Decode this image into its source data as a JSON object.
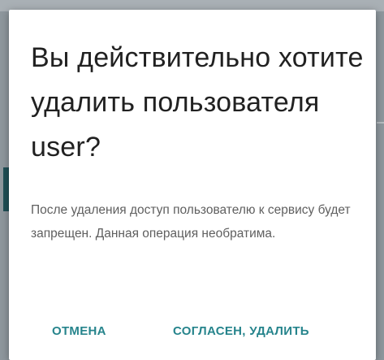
{
  "dialog": {
    "title": "Вы действительно хотите удалить пользователя user?",
    "message": "После удаления доступ пользователю к сервису будет запрещен. Данная операция необратима.",
    "actions": {
      "cancel_label": "ОТМЕНА",
      "confirm_label": "СОГЛАСЕН, УДАЛИТЬ"
    }
  },
  "colors": {
    "accent": "#26848c",
    "title_text": "#212121",
    "body_text": "#5f5f5f",
    "dialog_background": "#ffffff"
  }
}
